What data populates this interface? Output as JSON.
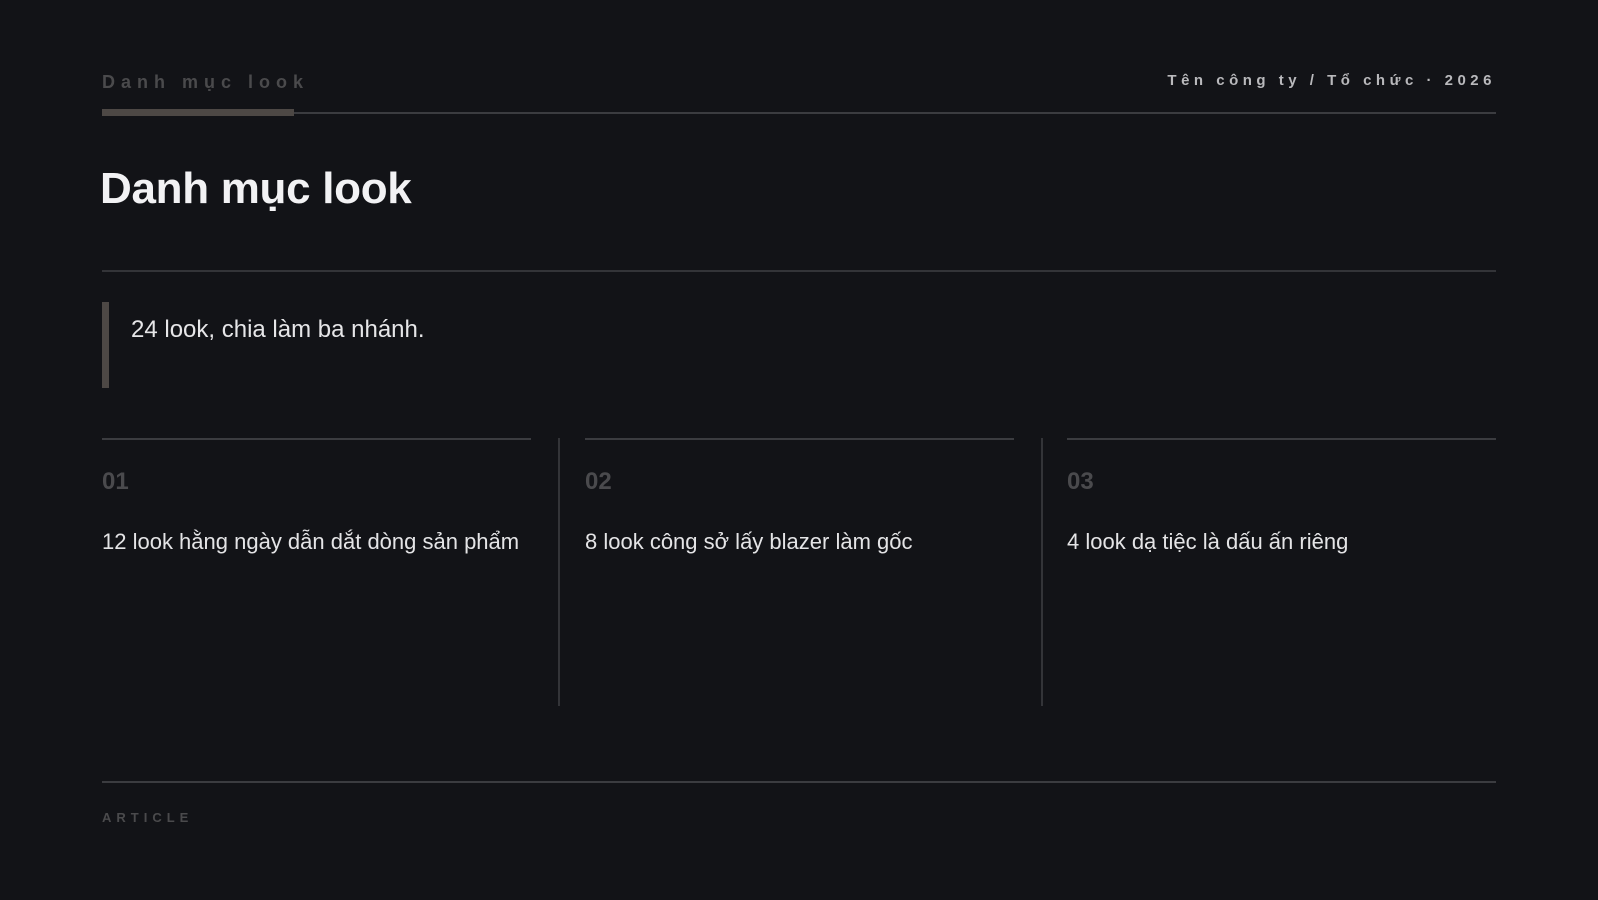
{
  "header": {
    "section_label": "Danh mục look",
    "organization": "Tên công ty / Tổ chức · 2026"
  },
  "title": "Danh mục look",
  "lead": "24 look, chia làm ba nhánh.",
  "columns": [
    {
      "number": "01",
      "text": "12 look hằng ngày dẫn dắt dòng sản phẩm"
    },
    {
      "number": "02",
      "text": "8 look công sở lấy blazer làm gốc"
    },
    {
      "number": "03",
      "text": "4 look dạ tiệc là dấu ấn riêng"
    }
  ],
  "footer": {
    "label": "ARTICLE"
  },
  "colors": {
    "background": "#121317",
    "accent": "#4d4845",
    "text": "#f2f2f4"
  }
}
